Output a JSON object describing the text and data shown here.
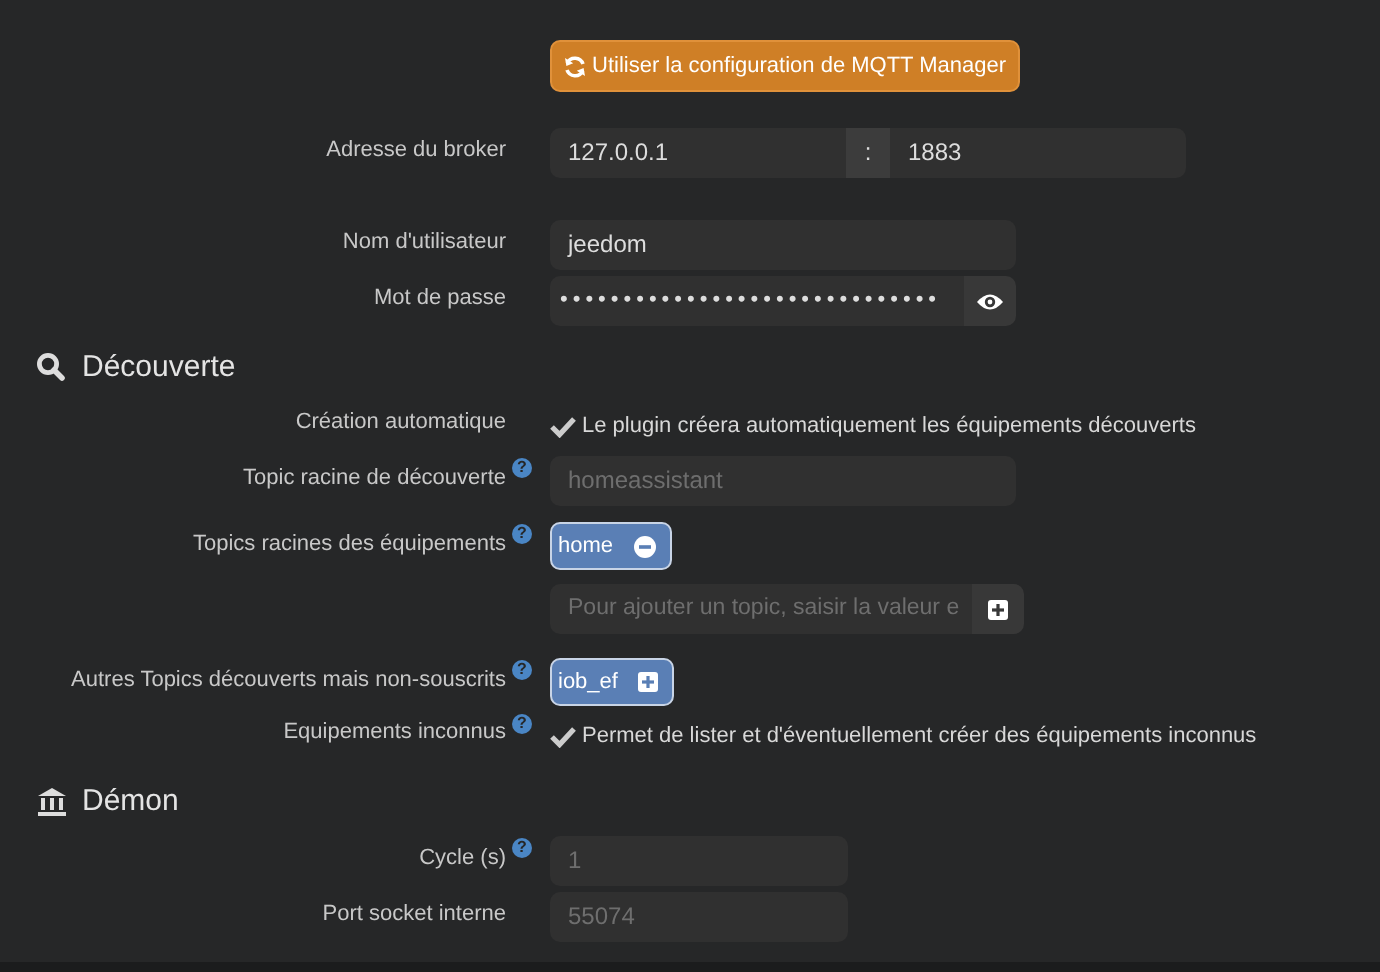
{
  "sections": [
    {
      "rows": [
        {
          "kind": "button",
          "text": "Utiliser la configuration de MQTT Manager"
        },
        {
          "kind": "host_port",
          "label": "Adresse du broker",
          "host": "127.0.0.1",
          "separator": ":",
          "port": "1883"
        },
        {
          "kind": "text",
          "label": "Nom d'utilisateur",
          "value": "jeedom"
        },
        {
          "kind": "password",
          "label": "Mot de passe",
          "value": "••••••••••••••••••••••••••••••"
        }
      ]
    },
    {
      "heading": "Découverte",
      "rows": [
        {
          "kind": "checkbox",
          "label": "Création automatique",
          "checked": true,
          "text": "Le plugin créera automatiquement les équipements découverts"
        },
        {
          "kind": "text",
          "label": "Topic racine de découverte",
          "help": "?",
          "placeholder": "homeassistant"
        },
        {
          "kind": "tags",
          "label": "Topics racines des équipements",
          "help": "?",
          "tags": [
            {
              "label": "home",
              "kind": "removable"
            }
          ]
        },
        {
          "kind": "add_field",
          "placeholder": "Pour ajouter un topic, saisir la valeur e"
        },
        {
          "kind": "tags",
          "label": "Autres Topics découverts mais non-souscrits",
          "help": "?",
          "tags": [
            {
              "label": "iob_ef",
              "kind": "addable"
            }
          ]
        },
        {
          "kind": "checkbox",
          "label": "Equipements inconnus",
          "help": "?",
          "checked": true,
          "text": "Permet de lister et d'éventuellement créer des équipements inconnus"
        }
      ]
    },
    {
      "heading": "Démon",
      "rows": [
        {
          "kind": "short",
          "label": "Cycle (s)",
          "help": "?",
          "placeholder": "1"
        },
        {
          "kind": "short",
          "label": "Port socket interne",
          "placeholder": "55074"
        }
      ]
    }
  ]
}
